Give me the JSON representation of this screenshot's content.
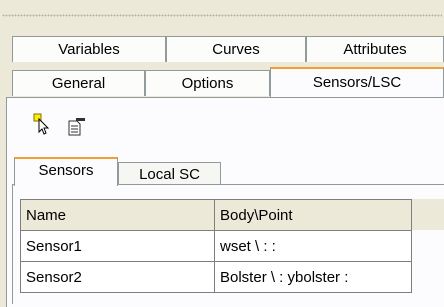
{
  "top_tabs_row1": [
    {
      "label": "Variables"
    },
    {
      "label": "Curves"
    },
    {
      "label": "Attributes"
    }
  ],
  "top_tabs_row2": [
    {
      "label": "General"
    },
    {
      "label": "Options"
    },
    {
      "label": "Sensors/LSC",
      "active": true
    }
  ],
  "toolbar": {
    "select_icon": "pointer-select-icon",
    "properties_icon": "document-properties-icon"
  },
  "inner_tabs": [
    {
      "label": "Sensors",
      "active": true
    },
    {
      "label": "Local SC"
    }
  ],
  "sensors_table": {
    "columns": [
      "Name",
      "Body\\Point"
    ],
    "rows": [
      [
        "Sensor1",
        "wset \\ : :"
      ],
      [
        "Sensor2",
        "Bolster \\ : ybolster :"
      ]
    ]
  },
  "colors": {
    "active_tab_accent": "#f0a030",
    "dialog_background": "#ece9d8"
  }
}
